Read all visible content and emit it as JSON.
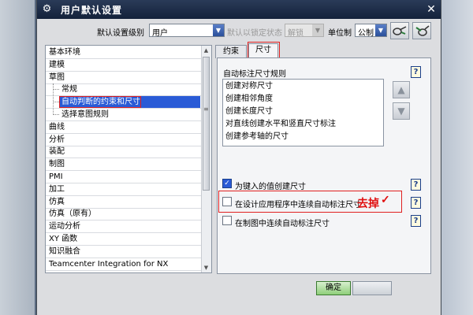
{
  "window": {
    "title": "用户默认设置"
  },
  "toolbar": {
    "level_label": "默认设置级别",
    "level_value": "用户",
    "lock_label": "默认以锁定状态",
    "lock_value": "解锁",
    "unit_label": "单位制",
    "unit_value": "公制"
  },
  "tree": {
    "items": [
      {
        "label": "基本环境",
        "indent": 0
      },
      {
        "label": "建模",
        "indent": 0
      },
      {
        "label": "草图",
        "indent": 0
      },
      {
        "label": "常规",
        "indent": 1
      },
      {
        "label": "自动判断的约束和尺寸",
        "indent": 1,
        "selected": true
      },
      {
        "label": "选择意图规则",
        "indent": 1
      },
      {
        "label": "曲线",
        "indent": 0
      },
      {
        "label": "分析",
        "indent": 0
      },
      {
        "label": "装配",
        "indent": 0
      },
      {
        "label": "制图",
        "indent": 0
      },
      {
        "label": "PMI",
        "indent": 0
      },
      {
        "label": "加工",
        "indent": 0
      },
      {
        "label": "仿真",
        "indent": 0
      },
      {
        "label": "仿真（原有）",
        "indent": 0
      },
      {
        "label": "运动分析",
        "indent": 0
      },
      {
        "label": "XY 函数",
        "indent": 0
      },
      {
        "label": "知识融合",
        "indent": 0
      },
      {
        "label": "Teamcenter Integration for NX",
        "indent": 0
      }
    ]
  },
  "tabs": [
    {
      "label": "约束",
      "active": false
    },
    {
      "label": "尺寸",
      "active": true
    }
  ],
  "dimension_panel": {
    "group_label": "自动标注尺寸规则",
    "rules": [
      "创建对称尺寸",
      "创建相邻角度",
      "创建长度尺寸",
      "对直线创建水平和竖直尺寸标注",
      "创建参考轴的尺寸"
    ],
    "options": [
      {
        "label": "为键入的值创建尺寸",
        "checked": true
      },
      {
        "label": "在设计应用程序中连续自动标注尺寸",
        "checked": false
      },
      {
        "label": "在制图中连续自动标注尺寸",
        "checked": false
      }
    ],
    "help_symbol": "?"
  },
  "annotation": {
    "text": "去掉",
    "mark": "✓"
  },
  "buttons": {
    "ok": "确定"
  },
  "colors": {
    "highlight": "#e02020",
    "selection": "#2a5bd6",
    "title_bar": "#1a2a48"
  }
}
